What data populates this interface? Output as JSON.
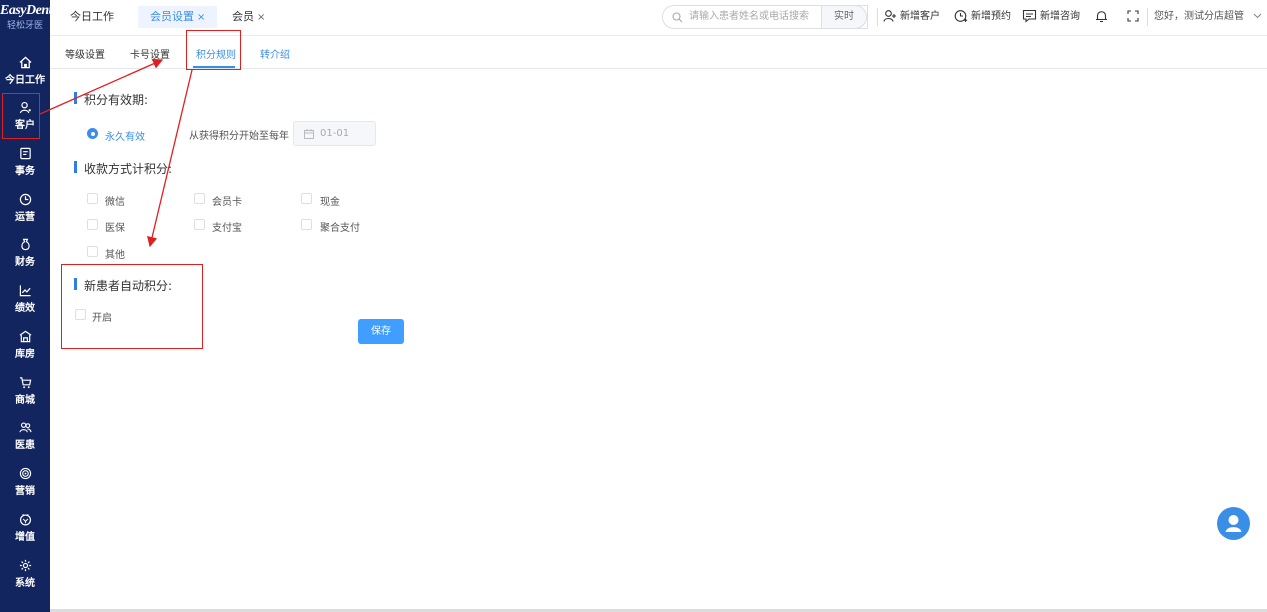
{
  "logo": {
    "brand": "EasyDent",
    "tagline": "轻松牙医"
  },
  "sidebar": {
    "items": [
      {
        "label": "今日工作",
        "icon": "home-icon"
      },
      {
        "label": "客户",
        "icon": "user-icon"
      },
      {
        "label": "事务",
        "icon": "clipboard-icon"
      },
      {
        "label": "运营",
        "icon": "clock-icon"
      },
      {
        "label": "财务",
        "icon": "money-bag-icon"
      },
      {
        "label": "绩效",
        "icon": "line-chart-icon"
      },
      {
        "label": "库房",
        "icon": "warehouse-icon"
      },
      {
        "label": "商城",
        "icon": "cart-icon"
      },
      {
        "label": "医患",
        "icon": "people-icon"
      },
      {
        "label": "营销",
        "icon": "target-icon"
      },
      {
        "label": "增值",
        "icon": "coin-icon"
      },
      {
        "label": "系统",
        "icon": "gear-icon"
      }
    ]
  },
  "topbar": {
    "tabs": [
      {
        "label": "今日工作",
        "close": ""
      },
      {
        "label": "会员设置",
        "close": "×"
      },
      {
        "label": "会员",
        "close": "×"
      }
    ],
    "search_placeholder": "请输入患者姓名或电话搜索",
    "realtime": "实时",
    "new_customer": "新增客户",
    "new_appointment": "新增预约",
    "new_consult": "新增咨询",
    "greeting": "您好，测试分店超管"
  },
  "subtabs": [
    "等级设置",
    "卡号设置",
    "积分规则",
    "转介绍"
  ],
  "points_validity": {
    "title": "积分有效期:",
    "option_permanent": "永久有效",
    "option_yearly": "从获得积分开始至每年",
    "date_value": "01-01"
  },
  "payment_methods": {
    "title": "收款方式计积分:",
    "options": [
      "微信",
      "会员卡",
      "现金",
      "医保",
      "支付宝",
      "聚合支付",
      "其他"
    ]
  },
  "new_patient": {
    "title": "新患者自动积分:",
    "option": "开启"
  },
  "save_label": "保存",
  "colors": {
    "sidebar": "#13255e",
    "accent": "#409eff",
    "highlight": "#e02020"
  }
}
